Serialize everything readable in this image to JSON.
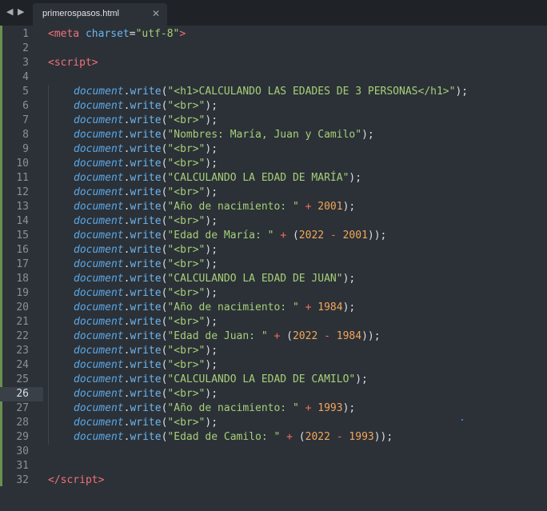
{
  "tab": {
    "title": "primerospasos.html"
  },
  "icons": {
    "nav_left": "triangle-left",
    "nav_right": "triangle-right",
    "close": "close-x"
  },
  "active_line": 26,
  "lines": [
    {
      "n": "1",
      "indent": false,
      "tokens": [
        {
          "t": "<",
          "c": "kw"
        },
        {
          "t": "meta",
          "c": "kw"
        },
        {
          "t": " ",
          "c": "pn"
        },
        {
          "t": "charset",
          "c": "fn"
        },
        {
          "t": "=",
          "c": "pn"
        },
        {
          "t": "\"utf-8\"",
          "c": "str"
        },
        {
          "t": ">",
          "c": "kw"
        }
      ]
    },
    {
      "n": "2",
      "indent": false,
      "tokens": []
    },
    {
      "n": "3",
      "indent": false,
      "tokens": [
        {
          "t": "<",
          "c": "kw"
        },
        {
          "t": "script",
          "c": "kw"
        },
        {
          "t": ">",
          "c": "kw"
        }
      ]
    },
    {
      "n": "4",
      "indent": false,
      "tokens": []
    },
    {
      "n": "5",
      "indent": true,
      "tokens": [
        {
          "t": "document",
          "c": "obj"
        },
        {
          "t": ".",
          "c": "pn"
        },
        {
          "t": "write",
          "c": "fn"
        },
        {
          "t": "(",
          "c": "pn"
        },
        {
          "t": "\"<h1>CALCULANDO LAS EDADES DE 3 PERSONAS</h1>\"",
          "c": "str"
        },
        {
          "t": ");",
          "c": "pn"
        }
      ]
    },
    {
      "n": "6",
      "indent": true,
      "tokens": [
        {
          "t": "document",
          "c": "obj"
        },
        {
          "t": ".",
          "c": "pn"
        },
        {
          "t": "write",
          "c": "fn"
        },
        {
          "t": "(",
          "c": "pn"
        },
        {
          "t": "\"<br>\"",
          "c": "str"
        },
        {
          "t": ");",
          "c": "pn"
        }
      ]
    },
    {
      "n": "7",
      "indent": true,
      "tokens": [
        {
          "t": "document",
          "c": "obj"
        },
        {
          "t": ".",
          "c": "pn"
        },
        {
          "t": "write",
          "c": "fn"
        },
        {
          "t": "(",
          "c": "pn"
        },
        {
          "t": "\"<br>\"",
          "c": "str"
        },
        {
          "t": ");",
          "c": "pn"
        }
      ]
    },
    {
      "n": "8",
      "indent": true,
      "tokens": [
        {
          "t": "document",
          "c": "obj"
        },
        {
          "t": ".",
          "c": "pn"
        },
        {
          "t": "write",
          "c": "fn"
        },
        {
          "t": "(",
          "c": "pn"
        },
        {
          "t": "\"Nombres: María, Juan y Camilo\"",
          "c": "str"
        },
        {
          "t": ");",
          "c": "pn"
        }
      ]
    },
    {
      "n": "9",
      "indent": true,
      "tokens": [
        {
          "t": "document",
          "c": "obj"
        },
        {
          "t": ".",
          "c": "pn"
        },
        {
          "t": "write",
          "c": "fn"
        },
        {
          "t": "(",
          "c": "pn"
        },
        {
          "t": "\"<br>\"",
          "c": "str"
        },
        {
          "t": ");",
          "c": "pn"
        }
      ]
    },
    {
      "n": "10",
      "indent": true,
      "tokens": [
        {
          "t": "document",
          "c": "obj"
        },
        {
          "t": ".",
          "c": "pn"
        },
        {
          "t": "write",
          "c": "fn"
        },
        {
          "t": "(",
          "c": "pn"
        },
        {
          "t": "\"<br>\"",
          "c": "str"
        },
        {
          "t": ");",
          "c": "pn"
        }
      ]
    },
    {
      "n": "11",
      "indent": true,
      "tokens": [
        {
          "t": "document",
          "c": "obj"
        },
        {
          "t": ".",
          "c": "pn"
        },
        {
          "t": "write",
          "c": "fn"
        },
        {
          "t": "(",
          "c": "pn"
        },
        {
          "t": "\"CALCULANDO LA EDAD DE MARÍA\"",
          "c": "str"
        },
        {
          "t": ");",
          "c": "pn"
        }
      ]
    },
    {
      "n": "12",
      "indent": true,
      "tokens": [
        {
          "t": "document",
          "c": "obj"
        },
        {
          "t": ".",
          "c": "pn"
        },
        {
          "t": "write",
          "c": "fn"
        },
        {
          "t": "(",
          "c": "pn"
        },
        {
          "t": "\"<br>\"",
          "c": "str"
        },
        {
          "t": ");",
          "c": "pn"
        }
      ]
    },
    {
      "n": "13",
      "indent": true,
      "tokens": [
        {
          "t": "document",
          "c": "obj"
        },
        {
          "t": ".",
          "c": "pn"
        },
        {
          "t": "write",
          "c": "fn"
        },
        {
          "t": "(",
          "c": "pn"
        },
        {
          "t": "\"Año de nacimiento: \"",
          "c": "str"
        },
        {
          "t": " ",
          "c": "pn"
        },
        {
          "t": "+",
          "c": "op"
        },
        {
          "t": " ",
          "c": "pn"
        },
        {
          "t": "2001",
          "c": "num"
        },
        {
          "t": ");",
          "c": "pn"
        }
      ]
    },
    {
      "n": "14",
      "indent": true,
      "tokens": [
        {
          "t": "document",
          "c": "obj"
        },
        {
          "t": ".",
          "c": "pn"
        },
        {
          "t": "write",
          "c": "fn"
        },
        {
          "t": "(",
          "c": "pn"
        },
        {
          "t": "\"<br>\"",
          "c": "str"
        },
        {
          "t": ");",
          "c": "pn"
        }
      ]
    },
    {
      "n": "15",
      "indent": true,
      "tokens": [
        {
          "t": "document",
          "c": "obj"
        },
        {
          "t": ".",
          "c": "pn"
        },
        {
          "t": "write",
          "c": "fn"
        },
        {
          "t": "(",
          "c": "pn"
        },
        {
          "t": "\"Edad de María: \"",
          "c": "str"
        },
        {
          "t": " ",
          "c": "pn"
        },
        {
          "t": "+",
          "c": "op"
        },
        {
          "t": " (",
          "c": "pn"
        },
        {
          "t": "2022",
          "c": "num"
        },
        {
          "t": " ",
          "c": "pn"
        },
        {
          "t": "-",
          "c": "op"
        },
        {
          "t": " ",
          "c": "pn"
        },
        {
          "t": "2001",
          "c": "num"
        },
        {
          "t": "));",
          "c": "pn"
        }
      ]
    },
    {
      "n": "16",
      "indent": true,
      "tokens": [
        {
          "t": "document",
          "c": "obj"
        },
        {
          "t": ".",
          "c": "pn"
        },
        {
          "t": "write",
          "c": "fn"
        },
        {
          "t": "(",
          "c": "pn"
        },
        {
          "t": "\"<br>\"",
          "c": "str"
        },
        {
          "t": ");",
          "c": "pn"
        }
      ]
    },
    {
      "n": "17",
      "indent": true,
      "tokens": [
        {
          "t": "document",
          "c": "obj"
        },
        {
          "t": ".",
          "c": "pn"
        },
        {
          "t": "write",
          "c": "fn"
        },
        {
          "t": "(",
          "c": "pn"
        },
        {
          "t": "\"<br>\"",
          "c": "str"
        },
        {
          "t": ");",
          "c": "pn"
        }
      ]
    },
    {
      "n": "18",
      "indent": true,
      "tokens": [
        {
          "t": "document",
          "c": "obj"
        },
        {
          "t": ".",
          "c": "pn"
        },
        {
          "t": "write",
          "c": "fn"
        },
        {
          "t": "(",
          "c": "pn"
        },
        {
          "t": "\"CALCULANDO LA EDAD DE JUAN\"",
          "c": "str"
        },
        {
          "t": ");",
          "c": "pn"
        }
      ]
    },
    {
      "n": "19",
      "indent": true,
      "tokens": [
        {
          "t": "document",
          "c": "obj"
        },
        {
          "t": ".",
          "c": "pn"
        },
        {
          "t": "write",
          "c": "fn"
        },
        {
          "t": "(",
          "c": "pn"
        },
        {
          "t": "\"<br>\"",
          "c": "str"
        },
        {
          "t": ");",
          "c": "pn"
        }
      ]
    },
    {
      "n": "20",
      "indent": true,
      "tokens": [
        {
          "t": "document",
          "c": "obj"
        },
        {
          "t": ".",
          "c": "pn"
        },
        {
          "t": "write",
          "c": "fn"
        },
        {
          "t": "(",
          "c": "pn"
        },
        {
          "t": "\"Año de nacimiento: \"",
          "c": "str"
        },
        {
          "t": " ",
          "c": "pn"
        },
        {
          "t": "+",
          "c": "op"
        },
        {
          "t": " ",
          "c": "pn"
        },
        {
          "t": "1984",
          "c": "num"
        },
        {
          "t": ");",
          "c": "pn"
        }
      ]
    },
    {
      "n": "21",
      "indent": true,
      "tokens": [
        {
          "t": "document",
          "c": "obj"
        },
        {
          "t": ".",
          "c": "pn"
        },
        {
          "t": "write",
          "c": "fn"
        },
        {
          "t": "(",
          "c": "pn"
        },
        {
          "t": "\"<br>\"",
          "c": "str"
        },
        {
          "t": ");",
          "c": "pn"
        }
      ]
    },
    {
      "n": "22",
      "indent": true,
      "tokens": [
        {
          "t": "document",
          "c": "obj"
        },
        {
          "t": ".",
          "c": "pn"
        },
        {
          "t": "write",
          "c": "fn"
        },
        {
          "t": "(",
          "c": "pn"
        },
        {
          "t": "\"Edad de Juan: \"",
          "c": "str"
        },
        {
          "t": " ",
          "c": "pn"
        },
        {
          "t": "+",
          "c": "op"
        },
        {
          "t": " (",
          "c": "pn"
        },
        {
          "t": "2022",
          "c": "num"
        },
        {
          "t": " ",
          "c": "pn"
        },
        {
          "t": "-",
          "c": "op"
        },
        {
          "t": " ",
          "c": "pn"
        },
        {
          "t": "1984",
          "c": "num"
        },
        {
          "t": "));",
          "c": "pn"
        }
      ]
    },
    {
      "n": "23",
      "indent": true,
      "tokens": [
        {
          "t": "document",
          "c": "obj"
        },
        {
          "t": ".",
          "c": "pn"
        },
        {
          "t": "write",
          "c": "fn"
        },
        {
          "t": "(",
          "c": "pn"
        },
        {
          "t": "\"<br>\"",
          "c": "str"
        },
        {
          "t": ");",
          "c": "pn"
        }
      ]
    },
    {
      "n": "24",
      "indent": true,
      "tokens": [
        {
          "t": "document",
          "c": "obj"
        },
        {
          "t": ".",
          "c": "pn"
        },
        {
          "t": "write",
          "c": "fn"
        },
        {
          "t": "(",
          "c": "pn"
        },
        {
          "t": "\"<br>\"",
          "c": "str"
        },
        {
          "t": ");",
          "c": "pn"
        }
      ]
    },
    {
      "n": "25",
      "indent": true,
      "tokens": [
        {
          "t": "document",
          "c": "obj"
        },
        {
          "t": ".",
          "c": "pn"
        },
        {
          "t": "write",
          "c": "fn"
        },
        {
          "t": "(",
          "c": "pn"
        },
        {
          "t": "\"CALCULANDO LA EDAD DE CAMILO\"",
          "c": "str"
        },
        {
          "t": ");",
          "c": "pn"
        }
      ]
    },
    {
      "n": "26",
      "indent": true,
      "tokens": [
        {
          "t": "document",
          "c": "obj"
        },
        {
          "t": ".",
          "c": "pn"
        },
        {
          "t": "write",
          "c": "fn"
        },
        {
          "t": "(",
          "c": "pn"
        },
        {
          "t": "\"<br>\"",
          "c": "str"
        },
        {
          "t": ");",
          "c": "pn"
        }
      ]
    },
    {
      "n": "27",
      "indent": true,
      "tokens": [
        {
          "t": "document",
          "c": "obj"
        },
        {
          "t": ".",
          "c": "pn"
        },
        {
          "t": "write",
          "c": "fn"
        },
        {
          "t": "(",
          "c": "pn"
        },
        {
          "t": "\"Año de nacimiento: \"",
          "c": "str"
        },
        {
          "t": " ",
          "c": "pn"
        },
        {
          "t": "+",
          "c": "op"
        },
        {
          "t": " ",
          "c": "pn"
        },
        {
          "t": "1993",
          "c": "num"
        },
        {
          "t": ");",
          "c": "pn"
        }
      ]
    },
    {
      "n": "28",
      "indent": true,
      "tokens": [
        {
          "t": "document",
          "c": "obj"
        },
        {
          "t": ".",
          "c": "pn"
        },
        {
          "t": "write",
          "c": "fn"
        },
        {
          "t": "(",
          "c": "pn"
        },
        {
          "t": "\"<br>\"",
          "c": "str"
        },
        {
          "t": ");",
          "c": "pn"
        }
      ]
    },
    {
      "n": "29",
      "indent": true,
      "tokens": [
        {
          "t": "document",
          "c": "obj"
        },
        {
          "t": ".",
          "c": "pn"
        },
        {
          "t": "write",
          "c": "fn"
        },
        {
          "t": "(",
          "c": "pn"
        },
        {
          "t": "\"Edad de Camilo: \"",
          "c": "str"
        },
        {
          "t": " ",
          "c": "pn"
        },
        {
          "t": "+",
          "c": "op"
        },
        {
          "t": " (",
          "c": "pn"
        },
        {
          "t": "2022",
          "c": "num"
        },
        {
          "t": " ",
          "c": "pn"
        },
        {
          "t": "-",
          "c": "op"
        },
        {
          "t": " ",
          "c": "pn"
        },
        {
          "t": "1993",
          "c": "num"
        },
        {
          "t": "));",
          "c": "pn"
        }
      ]
    },
    {
      "n": "30",
      "indent": false,
      "tokens": []
    },
    {
      "n": "31",
      "indent": false,
      "tokens": []
    },
    {
      "n": "32",
      "indent": false,
      "tokens": [
        {
          "t": "</",
          "c": "kw"
        },
        {
          "t": "script",
          "c": "kw"
        },
        {
          "t": ">",
          "c": "kw"
        }
      ]
    }
  ]
}
